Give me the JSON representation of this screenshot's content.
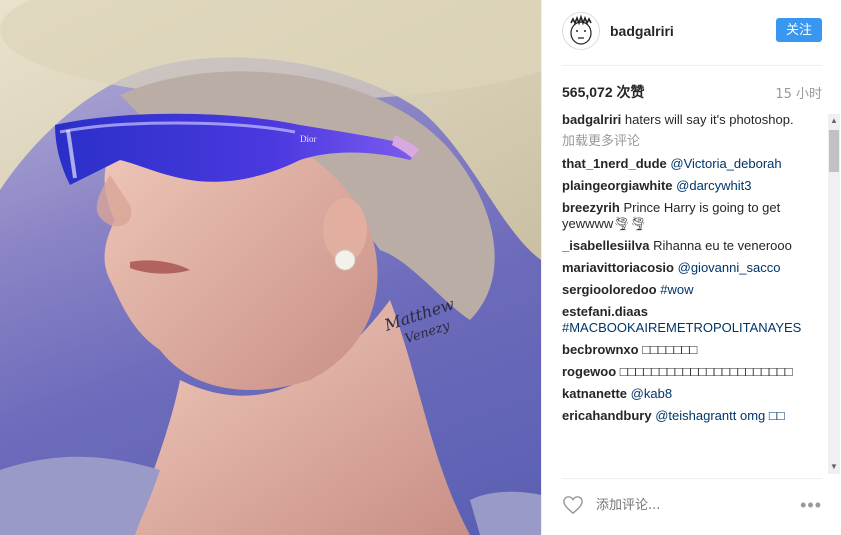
{
  "post": {
    "username": "badgalriri",
    "follow_label": "关注",
    "likes_count": "565,072",
    "likes_suffix": "次赞",
    "time_ago": "15 小时",
    "load_more": "加载更多评论",
    "comment_placeholder": "添加评论...",
    "more_label": "•••"
  },
  "photo": {
    "brand_on_glasses": "Dior",
    "signature_line1": "Matthew",
    "signature_line2": "Venezy"
  },
  "caption": {
    "user": "badgalriri",
    "text": "haters will say it's photoshop."
  },
  "comments": [
    {
      "user": "that_1nerd_dude",
      "text": "@Victoria_deborah",
      "link": true
    },
    {
      "user": "plaingeorgiawhite",
      "text": "@darcywhit3",
      "link": true
    },
    {
      "user": "breezyrih",
      "text": "Prince Harry is going to get yewwww🌪🌪",
      "link": false
    },
    {
      "user": "_isabellesiilva",
      "text": "Rihanna eu te venerooo",
      "link": false
    },
    {
      "user": "mariavittoriacosio",
      "text": "@giovanni_sacco",
      "link": true
    },
    {
      "user": "sergiooloredoo",
      "text": "#wow",
      "link": true
    },
    {
      "user": "estefani.diaas",
      "text": "#MACBOOKAIREMETROPOLITANAYES",
      "link": true
    },
    {
      "user": "becbrownxo",
      "text": "□□□□□□□",
      "link": false
    },
    {
      "user": "rogewoo",
      "text": "□□□□□□□□□□□□□□□□□□□□□□",
      "link": false
    },
    {
      "user": "katnanette",
      "text": "@kab8",
      "link": true
    },
    {
      "user": "ericahandbury",
      "text": "@teishagrantt omg □□",
      "link": true
    }
  ],
  "colors": {
    "accent": "#3897f0",
    "muted": "#999999",
    "link": "#003569"
  },
  "icons": {
    "like": "heart-outline-icon",
    "more": "more-dots-icon"
  }
}
